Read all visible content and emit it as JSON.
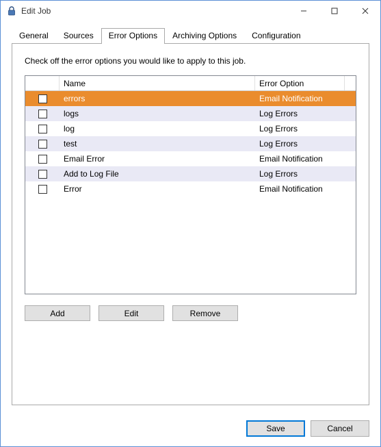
{
  "window": {
    "title": "Edit Job"
  },
  "tabs": {
    "items": [
      {
        "label": "General"
      },
      {
        "label": "Sources"
      },
      {
        "label": "Error Options"
      },
      {
        "label": "Archiving Options"
      },
      {
        "label": "Configuration"
      }
    ],
    "active_index": 2
  },
  "panel": {
    "instruction": "Check off the error options you would like to apply to this job."
  },
  "table": {
    "headers": {
      "name": "Name",
      "option": "Error Option"
    },
    "rows": [
      {
        "name": "errors",
        "option": "Email Notification",
        "selected": true,
        "alt": false
      },
      {
        "name": "logs",
        "option": "Log Errors",
        "selected": false,
        "alt": true
      },
      {
        "name": "log",
        "option": "Log Errors",
        "selected": false,
        "alt": false
      },
      {
        "name": "test",
        "option": "Log Errors",
        "selected": false,
        "alt": true
      },
      {
        "name": "Email Error",
        "option": "Email Notification",
        "selected": false,
        "alt": false
      },
      {
        "name": "Add to Log File",
        "option": "Log Errors",
        "selected": false,
        "alt": true
      },
      {
        "name": "Error",
        "option": "Email Notification",
        "selected": false,
        "alt": false
      }
    ]
  },
  "buttons": {
    "add": "Add",
    "edit": "Edit",
    "remove": "Remove",
    "save": "Save",
    "cancel": "Cancel"
  }
}
